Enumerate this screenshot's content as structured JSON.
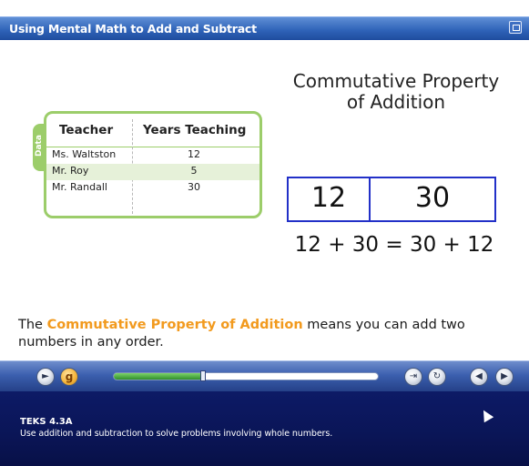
{
  "app": {
    "title": "Using Mental Math to Add and Subtract"
  },
  "content": {
    "property_title_line1": "Commutative Property",
    "property_title_line2": "of Addition",
    "table": {
      "tab_label": "Data",
      "headers": [
        "Teacher",
        "Years Teaching"
      ],
      "rows": [
        {
          "teacher": "Ms. Waltston",
          "years": "12"
        },
        {
          "teacher": "Mr. Roy",
          "years": "5"
        },
        {
          "teacher": "Mr. Randall",
          "years": "30"
        }
      ]
    },
    "bar_model": {
      "left": "12",
      "right": "30"
    },
    "equation": "12 + 30 = 30 + 12",
    "statement": {
      "prefix": "The ",
      "highlight": "Commutative Property of Addition",
      "suffix": " means you can add two numbers in any order."
    }
  },
  "controls": {
    "audio_icon": "speaker-icon",
    "glossary_label": "g",
    "progress": 0.34,
    "buttons": [
      "exit-icon",
      "replay-icon",
      "back-arrow-icon",
      "forward-arrow-icon"
    ]
  },
  "footer": {
    "teks_code": "TEKS 4.3A",
    "teks_desc": "Use addition and subtraction to solve problems involving whole numbers."
  },
  "colors": {
    "title_bar": "#2f63b8",
    "table_border": "#9ccd6a",
    "highlight": "#f29a1e",
    "bar_model": "#2230c8",
    "footer": "#0a1556"
  }
}
